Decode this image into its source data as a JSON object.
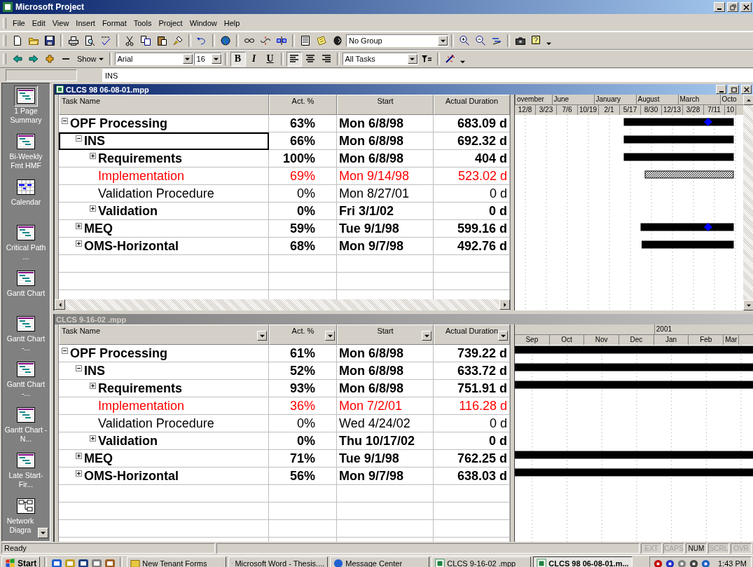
{
  "window": {
    "title": "Microsoft Project"
  },
  "menu": [
    "File",
    "Edit",
    "View",
    "Insert",
    "Format",
    "Tools",
    "Project",
    "Window",
    "Help"
  ],
  "toolbar": {
    "group": "No Group",
    "show": "Show",
    "font": "Arial",
    "size": "16",
    "filter": "All Tasks",
    "format_buttons": [
      {
        "label": "B",
        "kind": "bold",
        "on": true
      },
      {
        "label": "I",
        "kind": "italic",
        "on": false
      },
      {
        "label": "U",
        "kind": "underline",
        "on": false
      }
    ],
    "align_buttons": [
      {
        "kind": "left",
        "on": true
      },
      {
        "kind": "center",
        "on": false
      },
      {
        "kind": "right",
        "on": false
      }
    ]
  },
  "entry": {
    "value": "INS"
  },
  "view_bar": {
    "items": [
      {
        "label": "1 Page Summary",
        "kind": "gantt",
        "selected": true
      },
      {
        "label": "Bi-Weekly Fmt HMF",
        "kind": "gantt",
        "selected": false
      },
      {
        "label": "Calendar",
        "kind": "calendar",
        "selected": false
      },
      {
        "label": "Critical Path ...",
        "kind": "gantt",
        "selected": false
      },
      {
        "label": "Gantt Chart",
        "kind": "gantt",
        "selected": false
      },
      {
        "label": "Gantt Chart -...",
        "kind": "gantt",
        "selected": false
      },
      {
        "label": "Gantt Chart -...",
        "kind": "gantt",
        "selected": false
      },
      {
        "label": "Gantt Chart - N...",
        "kind": "gantt",
        "selected": false
      },
      {
        "label": "Late Start-Fir...",
        "kind": "gantt",
        "selected": false
      },
      {
        "label": "Network Diagra",
        "kind": "network",
        "selected": false
      }
    ]
  },
  "panes": [
    {
      "title": "CLCS 98 06-08-01.mpp",
      "active": true,
      "autofilter": false,
      "columns": [
        {
          "label": "Task Name"
        },
        {
          "label": "Act. %"
        },
        {
          "label": "Start"
        },
        {
          "label": "Actual Duration"
        }
      ],
      "tasks": [
        {
          "name": "OPF Processing",
          "kind": "summary",
          "expanded": true,
          "critical": false,
          "selected": false,
          "act": "63%",
          "start": "Mon 6/8/98",
          "duration": "683.09 d",
          "children": [
            {
              "name": "INS",
              "kind": "summary",
              "expanded": true,
              "critical": false,
              "selected": true,
              "act": "66%",
              "start": "Mon 6/8/98",
              "duration": "692.32 d",
              "children": [
                {
                  "name": "Requirements",
                  "kind": "summary",
                  "expanded": false,
                  "critical": false,
                  "selected": false,
                  "act": "100%",
                  "start": "Mon 6/8/98",
                  "duration": "404 d"
                },
                {
                  "name": "Implementation",
                  "kind": "task",
                  "critical": true,
                  "selected": false,
                  "act": "69%",
                  "start": "Mon 9/14/98",
                  "duration": "523.02 d"
                },
                {
                  "name": "Validation Procedure",
                  "kind": "task",
                  "critical": false,
                  "selected": false,
                  "act": "0%",
                  "start": "Mon 8/27/01",
                  "duration": "0 d"
                },
                {
                  "name": "Validation",
                  "kind": "summary",
                  "expanded": false,
                  "critical": false,
                  "selected": false,
                  "act": "0%",
                  "start": "Fri 3/1/02",
                  "duration": "0 d"
                }
              ]
            },
            {
              "name": "MEQ",
              "kind": "summary",
              "expanded": false,
              "critical": false,
              "selected": false,
              "act": "59%",
              "start": "Tue 9/1/98",
              "duration": "599.16 d"
            },
            {
              "name": "OMS-Horizontal",
              "kind": "summary",
              "expanded": false,
              "critical": false,
              "selected": false,
              "act": "68%",
              "start": "Mon 9/7/98",
              "duration": "492.76 d"
            }
          ]
        }
      ],
      "timescale_major": [
        "ovember",
        "June",
        "January",
        "August",
        "March",
        "Octo"
      ],
      "timescale_minor": [
        "12/8",
        "3/23",
        "7/6",
        "10/19",
        "2/1",
        "5/17",
        "8/30",
        "12/13",
        "3/28",
        "7/11",
        "10"
      ]
    },
    {
      "title": "CLCS  9-16-02 .mpp",
      "active": false,
      "autofilter": true,
      "columns": [
        {
          "label": "Task Name"
        },
        {
          "label": "Act. %"
        },
        {
          "label": "Start"
        },
        {
          "label": "Actual Duration"
        }
      ],
      "tasks": [
        {
          "name": "OPF Processing",
          "kind": "summary",
          "expanded": true,
          "critical": false,
          "selected": false,
          "act": "61%",
          "start": "Mon 6/8/98",
          "duration": "739.22 d",
          "children": [
            {
              "name": "INS",
              "kind": "summary",
              "expanded": true,
              "critical": false,
              "selected": false,
              "act": "52%",
              "start": "Mon 6/8/98",
              "duration": "633.72 d",
              "children": [
                {
                  "name": "Requirements",
                  "kind": "summary",
                  "expanded": false,
                  "critical": false,
                  "selected": false,
                  "act": "93%",
                  "start": "Mon 6/8/98",
                  "duration": "751.91 d"
                },
                {
                  "name": "Implementation",
                  "kind": "task",
                  "critical": true,
                  "selected": false,
                  "act": "36%",
                  "start": "Mon 7/2/01",
                  "duration": "116.28 d"
                },
                {
                  "name": "Validation Procedure",
                  "kind": "task",
                  "critical": false,
                  "selected": false,
                  "act": "0%",
                  "start": "Wed 4/24/02",
                  "duration": "0 d"
                },
                {
                  "name": "Validation",
                  "kind": "summary",
                  "expanded": false,
                  "critical": false,
                  "selected": false,
                  "act": "0%",
                  "start": "Thu 10/17/02",
                  "duration": "0 d"
                }
              ]
            },
            {
              "name": "MEQ",
              "kind": "summary",
              "expanded": false,
              "critical": false,
              "selected": false,
              "act": "71%",
              "start": "Tue 9/1/98",
              "duration": "762.25 d"
            },
            {
              "name": "OMS-Horizontal",
              "kind": "summary",
              "expanded": false,
              "critical": false,
              "selected": false,
              "act": "56%",
              "start": "Mon 9/7/98",
              "duration": "638.03 d"
            }
          ]
        }
      ],
      "timescale_major": [
        "2001"
      ],
      "timescale_minor": [
        "Sep",
        "Oct",
        "Nov",
        "Dec",
        "Jan",
        "Feb",
        "Mar"
      ]
    }
  ],
  "status": {
    "text": "Ready",
    "indicators": [
      {
        "label": "EXT",
        "on": false
      },
      {
        "label": "CAPS",
        "on": false
      },
      {
        "label": "NUM",
        "on": true
      },
      {
        "label": "SCRL",
        "on": false
      },
      {
        "label": "OVR",
        "on": false
      }
    ]
  },
  "taskbar": {
    "start": "Start",
    "tasks": [
      {
        "label": "New Tenant Forms",
        "kind": "folder",
        "selected": false
      },
      {
        "label": "Microsoft Word - Thesis....",
        "kind": "word",
        "selected": false
      },
      {
        "label": "Message Center",
        "kind": "info",
        "selected": false
      },
      {
        "label": "CLCS  9-16-02 .mpp",
        "kind": "project",
        "selected": false
      },
      {
        "label": "CLCS 98 06-08-01.m...",
        "kind": "project",
        "selected": true
      }
    ],
    "clock": "1:43 PM"
  }
}
